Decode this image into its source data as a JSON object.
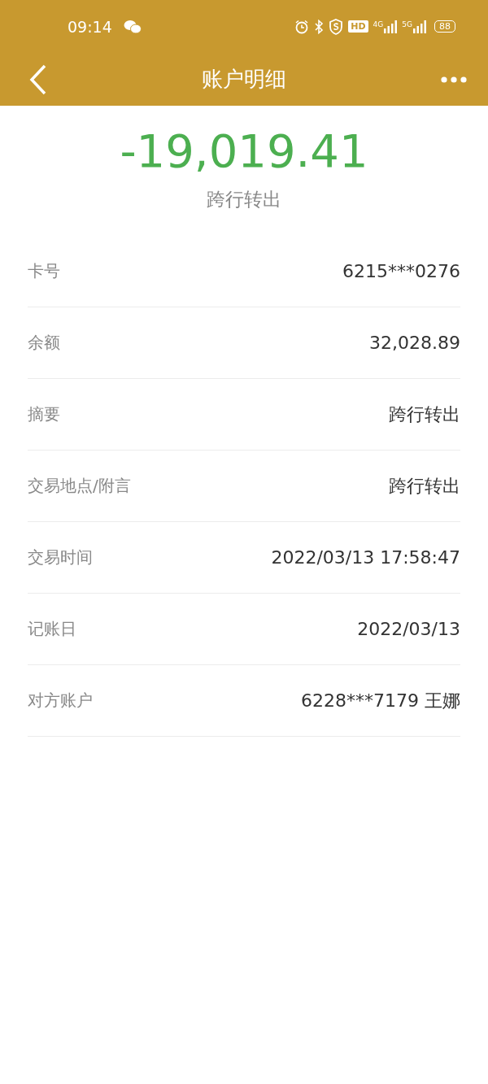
{
  "status_bar": {
    "time": "09:14",
    "network_1": "4G",
    "network_2": "5G",
    "hd": "HD",
    "battery": "88"
  },
  "nav": {
    "title": "账户明细"
  },
  "summary": {
    "amount": "-19,019.41",
    "type": "跨行转出"
  },
  "rows": [
    {
      "label": "卡号",
      "value": "6215***0276"
    },
    {
      "label": "余额",
      "value": "32,028.89"
    },
    {
      "label": "摘要",
      "value": "跨行转出"
    },
    {
      "label": "交易地点/附言",
      "value": "跨行转出"
    },
    {
      "label": "交易时间",
      "value": "2022/03/13 17:58:47"
    },
    {
      "label": "记账日",
      "value": "2022/03/13"
    },
    {
      "label": "对方账户",
      "value": "6228***7179 王娜"
    }
  ]
}
